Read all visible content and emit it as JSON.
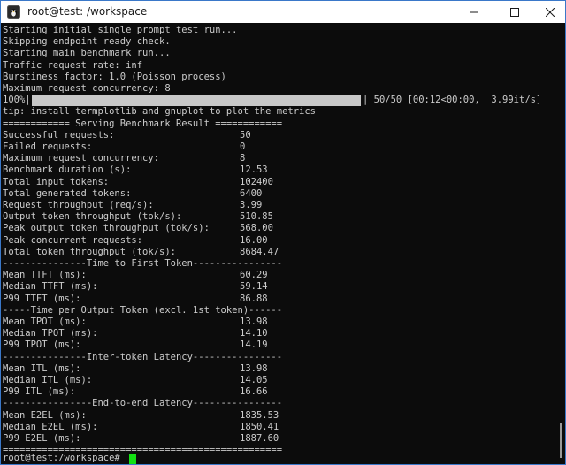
{
  "window": {
    "title": "root@test: /workspace",
    "icons": {
      "app": "terminal-penguin-icon",
      "minimize": "minimize-icon",
      "maximize": "maximize-icon",
      "close": "close-icon"
    },
    "colors": {
      "accent_border": "#3a78c9",
      "terminal_bg": "#0c0c0c",
      "text": "#cccccc",
      "cursor": "#13e013"
    }
  },
  "terminal": {
    "intro_lines": [
      "Starting initial single prompt test run...",
      "Skipping endpoint ready check.",
      "Starting main benchmark run...",
      "Traffic request rate: inf",
      "Burstiness factor: 1.0 (Poisson process)",
      "Maximum request concurrency: 8"
    ],
    "progress": {
      "percent_label": "100%|",
      "fraction": 1.0,
      "status": "| 50/50 [00:12<00:00,  3.99it/s]"
    },
    "tip": "tip: install termplotlib and gnuplot to plot the metrics",
    "header": "============ Serving Benchmark Result ============",
    "summary": [
      {
        "label": "Successful requests:",
        "value": "50"
      },
      {
        "label": "Failed requests:",
        "value": "0"
      },
      {
        "label": "Maximum request concurrency:",
        "value": "8"
      },
      {
        "label": "Benchmark duration (s):",
        "value": "12.53"
      },
      {
        "label": "Total input tokens:",
        "value": "102400"
      },
      {
        "label": "Total generated tokens:",
        "value": "6400"
      },
      {
        "label": "Request throughput (req/s):",
        "value": "3.99"
      },
      {
        "label": "Output token throughput (tok/s):",
        "value": "510.85"
      },
      {
        "label": "Peak output token throughput (tok/s):",
        "value": "568.00"
      },
      {
        "label": "Peak concurrent requests:",
        "value": "16.00"
      },
      {
        "label": "Total token throughput (tok/s):",
        "value": "8684.47"
      }
    ],
    "sections": [
      {
        "heading": "---------------Time to First Token----------------",
        "rows": [
          {
            "label": "Mean TTFT (ms):",
            "value": "60.29"
          },
          {
            "label": "Median TTFT (ms):",
            "value": "59.14"
          },
          {
            "label": "P99 TTFT (ms):",
            "value": "86.88"
          }
        ]
      },
      {
        "heading": "-----Time per Output Token (excl. 1st token)------",
        "rows": [
          {
            "label": "Mean TPOT (ms):",
            "value": "13.98"
          },
          {
            "label": "Median TPOT (ms):",
            "value": "14.10"
          },
          {
            "label": "P99 TPOT (ms):",
            "value": "14.19"
          }
        ]
      },
      {
        "heading": "---------------Inter-token Latency----------------",
        "rows": [
          {
            "label": "Mean ITL (ms):",
            "value": "13.98"
          },
          {
            "label": "Median ITL (ms):",
            "value": "14.05"
          },
          {
            "label": "P99 ITL (ms):",
            "value": "16.66"
          }
        ]
      },
      {
        "heading": "----------------End-to-end Latency----------------",
        "rows": [
          {
            "label": "Mean E2EL (ms):",
            "value": "1835.53"
          },
          {
            "label": "Median E2EL (ms):",
            "value": "1850.41"
          },
          {
            "label": "P99 E2EL (ms):",
            "value": "1887.60"
          }
        ]
      }
    ],
    "footer": "==================================================",
    "prompt": "root@test:/workspace# "
  }
}
